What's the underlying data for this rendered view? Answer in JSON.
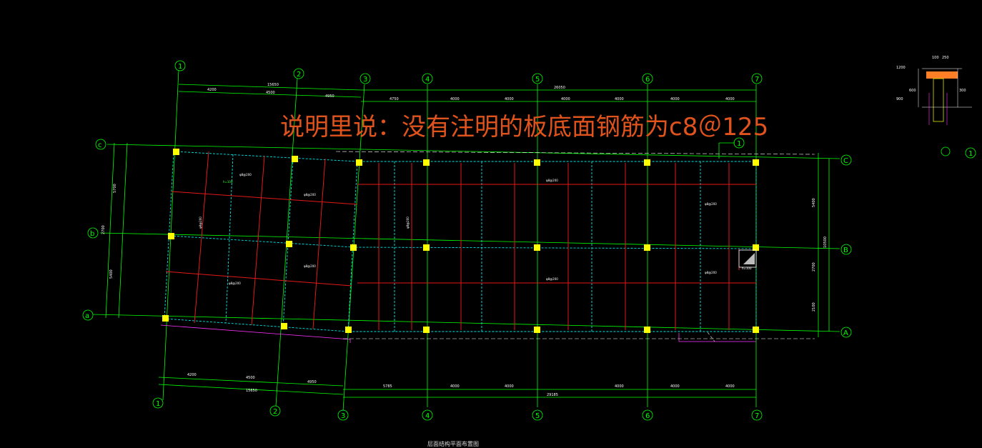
{
  "annotation": "说明里说：没有注明的板底面钢筋为c8＠125",
  "bottom_title": "层面结构平面布置图",
  "axes_top": [
    "1",
    "2",
    "3",
    "4",
    "5",
    "6",
    "7"
  ],
  "axes_bottom": [
    "1",
    "2",
    "3",
    "4",
    "5",
    "6",
    "7"
  ],
  "axes_right": [
    "C",
    "B",
    "A"
  ],
  "axes_left": [
    "c",
    "b",
    "a"
  ],
  "detail_marker": "1",
  "top_dimensions": {
    "overall_left": "15650",
    "segments_left": [
      "4200",
      "4500",
      "4950"
    ],
    "segments_right": [
      "4750",
      "4000",
      "4000",
      "4000",
      "4000",
      "4000",
      "4000"
    ],
    "overall_right": "26050"
  },
  "bottom_dimensions": {
    "segments_left": [
      "4200",
      "4500",
      "4950"
    ],
    "overall_left": "15650",
    "segments_right": [
      "5785",
      "4000",
      "4000",
      "4000",
      "4000",
      "4000"
    ],
    "overall_right": "29185"
  },
  "right_dimensions": [
    "5400",
    "2700",
    "2100",
    "10500"
  ],
  "left_dimensions": [
    "5700",
    "2700",
    "5400"
  ],
  "slab_labels": [
    "φ8@200",
    "φ8@200",
    "φ8@200",
    "φ8@200",
    "φ8@200",
    "φ8@200",
    "φ8@200",
    "φ8@200",
    "φ8@200",
    "φ8@200"
  ],
  "slab_thickness": [
    "h=100",
    "h=100"
  ],
  "detail_section_labels": [
    "1200",
    "100",
    "250",
    "600",
    "300",
    "900"
  ]
}
